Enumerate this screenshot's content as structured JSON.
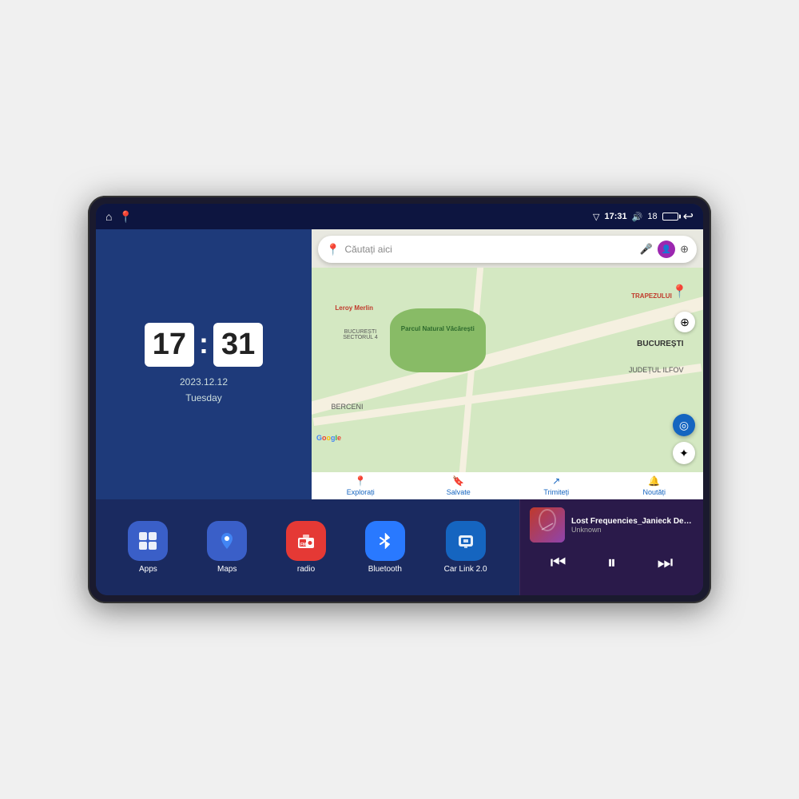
{
  "device": {
    "status_bar": {
      "left_icons": [
        "home",
        "maps-pin"
      ],
      "signal_icon": "▽",
      "time": "17:31",
      "volume_icon": "🔊",
      "battery_level": "18",
      "battery_icon": "battery",
      "back_icon": "↩"
    },
    "clock": {
      "hours": "17",
      "minutes": "31",
      "date": "2023.12.12",
      "day": "Tuesday"
    },
    "map": {
      "search_placeholder": "Căutați aici",
      "labels": {
        "park": "Parcul Natural Văcărești",
        "leroy": "Leroy Merlin",
        "sector": "BUCUREȘTI\nSECTORUL 4",
        "berceni": "BERCENI",
        "bucuresti": "BUCUREȘTI",
        "ilfov": "JUDEȚUL ILFOV",
        "trapezului": "TRAPEZULUI"
      },
      "nav_items": [
        {
          "icon": "📍",
          "label": "Explorați"
        },
        {
          "icon": "🔖",
          "label": "Salvate"
        },
        {
          "icon": "↗",
          "label": "Trimiteți"
        },
        {
          "icon": "🔔",
          "label": "Noutăți"
        }
      ]
    },
    "apps": [
      {
        "id": "apps",
        "label": "Apps",
        "icon": "⊞",
        "color": "icon-apps"
      },
      {
        "id": "maps",
        "label": "Maps",
        "icon": "📍",
        "color": "icon-maps"
      },
      {
        "id": "radio",
        "label": "radio",
        "icon": "📻",
        "color": "icon-radio"
      },
      {
        "id": "bluetooth",
        "label": "Bluetooth",
        "icon": "⬡",
        "color": "icon-bluetooth"
      },
      {
        "id": "carlink",
        "label": "Car Link 2.0",
        "icon": "📱",
        "color": "icon-carlink"
      }
    ],
    "music": {
      "title": "Lost Frequencies_Janieck Devy-...",
      "artist": "Unknown",
      "controls": {
        "prev": "⏮",
        "play": "⏸",
        "next": "⏭"
      }
    }
  }
}
